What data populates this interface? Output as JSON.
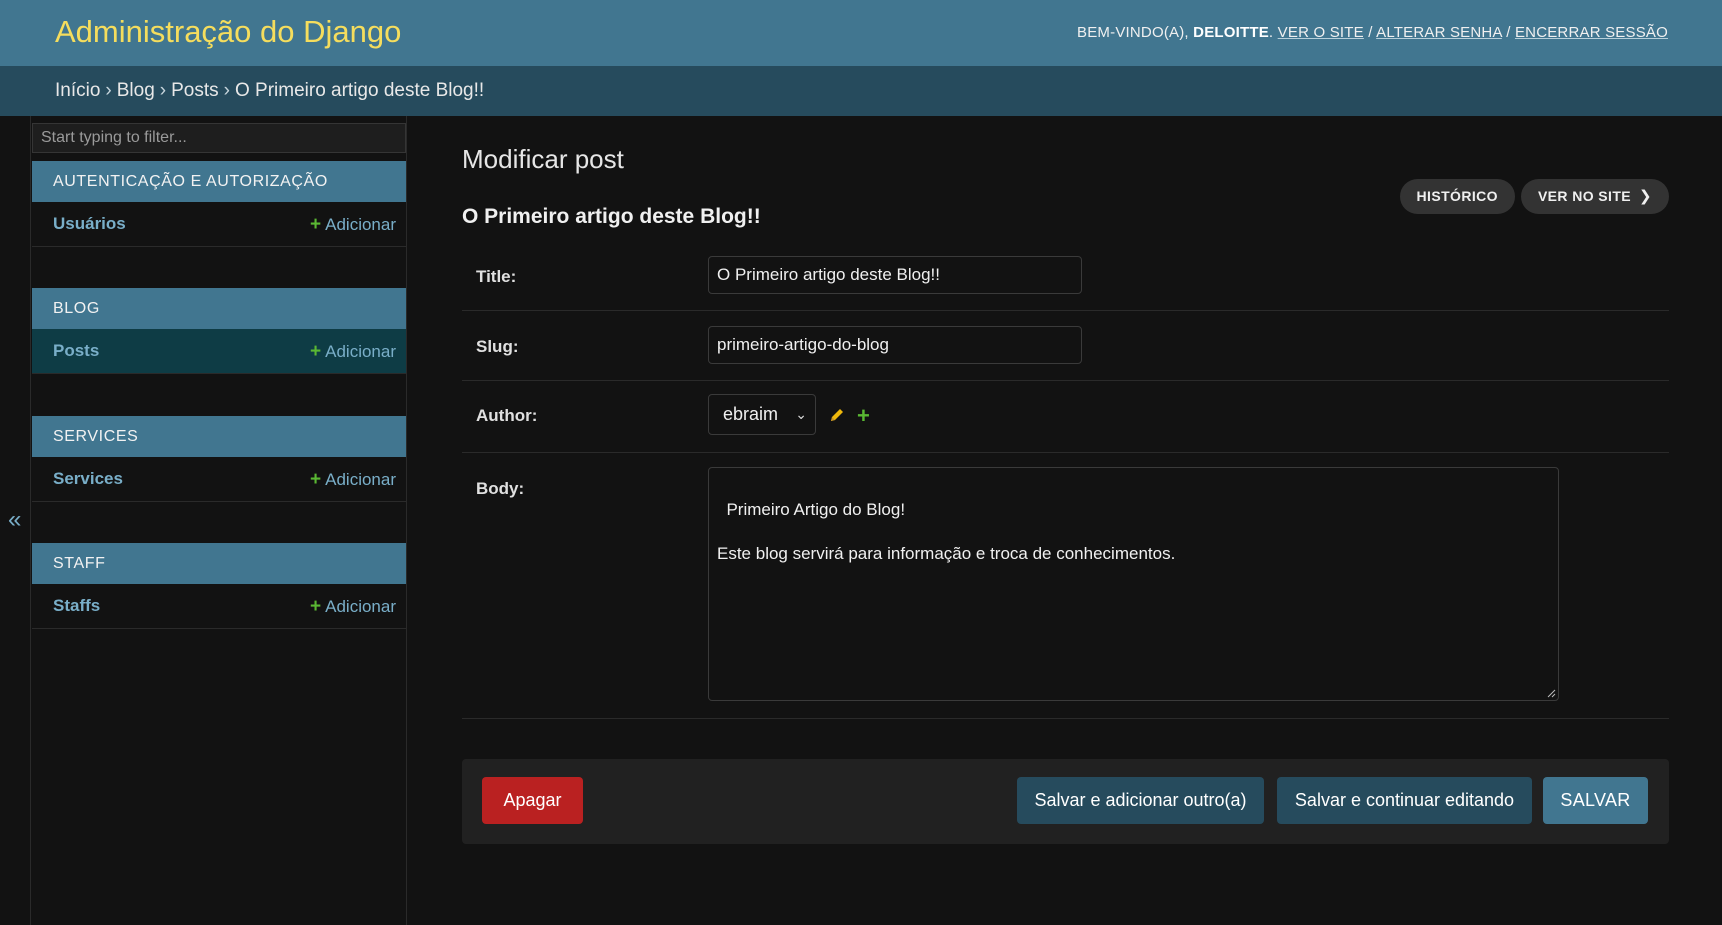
{
  "header": {
    "brand": "Administração do Django",
    "welcome_prefix": "BEM-VINDO(A), ",
    "user_name": "DELOITTE",
    "welcome_suffix": ". ",
    "links": [
      "VER O SITE",
      "ALTERAR SENHA",
      "ENCERRAR SESSÃO"
    ],
    "link_separator": " / "
  },
  "breadcrumbs": {
    "items": [
      "Início",
      "Blog",
      "Posts",
      "O Primeiro artigo deste Blog!!"
    ],
    "separator": "›"
  },
  "nav_toggle": {
    "glyph": "«",
    "icon": "double-chevron-left-icon"
  },
  "sidebar": {
    "filter_placeholder": "Start typing to filter...",
    "add_label": "Adicionar",
    "plus_glyph": "+",
    "modules": [
      {
        "caption": "AUTENTICAÇÃO E AUTORIZAÇÃO",
        "model": "Usuários",
        "active": false
      },
      {
        "caption": "BLOG",
        "model": "Posts",
        "active": true
      },
      {
        "caption": "SERVICES",
        "model": "Services",
        "active": false
      },
      {
        "caption": "STAFF",
        "model": "Staffs",
        "active": false
      }
    ]
  },
  "content": {
    "page_title": "Modificar post",
    "subtitle": "O Primeiro artigo deste Blog!!",
    "object_tools": {
      "history": "HISTÓRICO",
      "view_on_site": "VER NO SITE",
      "view_arrow": "❯"
    },
    "fields": {
      "title": {
        "label": "Title:",
        "value": "O Primeiro artigo deste Blog!!"
      },
      "slug": {
        "label": "Slug:",
        "value": "primeiro-artigo-do-blog"
      },
      "author": {
        "label": "Author:",
        "value": "ebraim",
        "caret": "⌄",
        "add_glyph": "+"
      },
      "body": {
        "label": "Body:",
        "value": "Primeiro Artigo do Blog!\n\nEste blog servirá para informação e troca de conhecimentos."
      }
    },
    "buttons": {
      "delete": "Apagar",
      "save_add": "Salvar e adicionar outro(a)",
      "save_continue": "Salvar e continuar editando",
      "save": "SALVAR"
    }
  },
  "colors": {
    "header_bg": "#417690",
    "breadcrumbs_bg": "#264b5d",
    "brand": "#f5dd5d",
    "link": "#79aec8",
    "add_plus": "#5ab833",
    "delete": "#ba2121",
    "background": "#121212"
  }
}
